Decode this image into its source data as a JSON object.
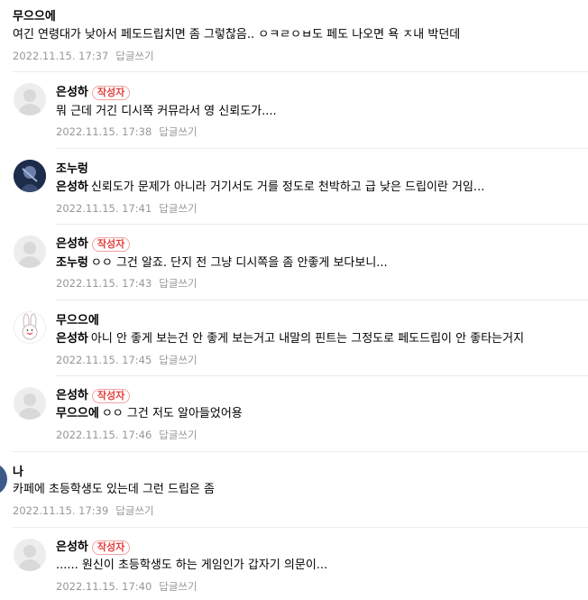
{
  "comments": [
    {
      "author": "무으으에",
      "text": "여긴 연령대가 낮아서 페도드립치면 좀 그렇찮음.. ㅇㅋㄹㅇㅂ도 페도 나오면 욕 ㅈ내 박던데",
      "date": "2022.11.15. 17:37",
      "reply": "답글쓰기"
    },
    {
      "author": "은성하",
      "badge": "작성자",
      "text": "뭐 근데 거긴 디시쪽 커뮤라서 영 신뢰도가....",
      "date": "2022.11.15. 17:38",
      "reply": "답글쓰기"
    },
    {
      "author": "조누렁",
      "mention": "은성하",
      "text": "신뢰도가 문제가 아니라 거기서도 거를 정도로 천박하고 급 낮은 드립이란 거임...",
      "date": "2022.11.15. 17:41",
      "reply": "답글쓰기"
    },
    {
      "author": "은성하",
      "badge": "작성자",
      "mention": "조누렁",
      "text": "ㅇㅇ 그건 알죠. 단지 전 그냥 디시쪽을 좀 안좋게 보다보니...",
      "date": "2022.11.15. 17:43",
      "reply": "답글쓰기"
    },
    {
      "author": "무으으에",
      "mention": "은성하",
      "text": "아니 안 좋게 보는건 안 좋게 보는거고 내말의 핀트는 그정도로 페도드립이 안 좋타는거지",
      "date": "2022.11.15. 17:45",
      "reply": "답글쓰기"
    },
    {
      "author": "은성하",
      "badge": "작성자",
      "mention": "무으으에",
      "text": "ㅇㅇ 그건 저도 알아들었어용",
      "date": "2022.11.15. 17:46",
      "reply": "답글쓰기"
    },
    {
      "author": "나",
      "text": "카페에 초등학생도 있는데 그런 드립은 좀",
      "date": "2022.11.15. 17:39",
      "reply": "답글쓰기"
    },
    {
      "author": "은성하",
      "badge": "작성자",
      "text": "...... 원신이 초등학생도 하는 게임인가 갑자기 의문이...",
      "date": "2022.11.15. 17:40",
      "reply": "답글쓰기"
    }
  ]
}
